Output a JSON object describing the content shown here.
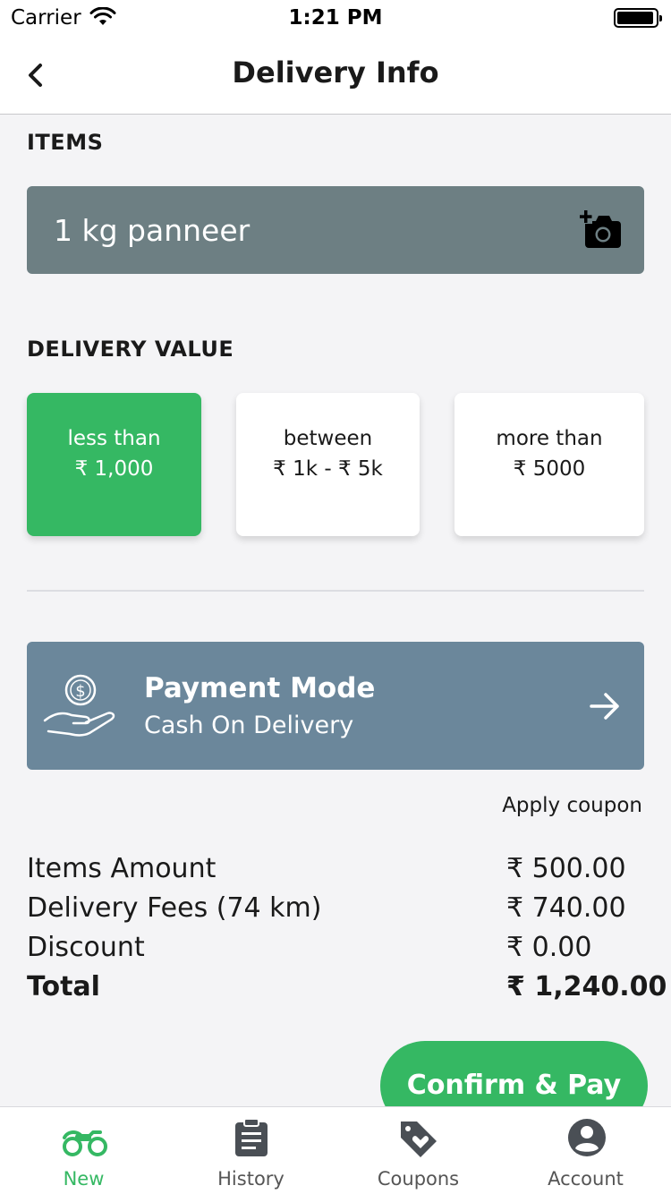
{
  "status_bar": {
    "carrier": "Carrier",
    "time": "1:21 PM"
  },
  "nav": {
    "title": "Delivery Info"
  },
  "items": {
    "label": "ITEMS",
    "value": "1 kg panneer"
  },
  "delivery_value": {
    "label": "DELIVERY VALUE",
    "options": [
      {
        "line1": "less than",
        "line2": "₹ 1,000",
        "selected": true
      },
      {
        "line1": "between",
        "line2": "₹ 1k - ₹ 5k",
        "selected": false
      },
      {
        "line1": "more than",
        "line2": "₹ 5000",
        "selected": false
      }
    ]
  },
  "payment": {
    "title": "Payment Mode",
    "subtitle": "Cash On Delivery"
  },
  "coupon": {
    "label": "Apply coupon"
  },
  "summary": [
    {
      "label": "Items Amount",
      "value": "₹ 500.00"
    },
    {
      "label": "Delivery Fees (74 km)",
      "value": "₹ 740.00"
    },
    {
      "label": "Discount",
      "value": "₹ 0.00"
    },
    {
      "label": "Total",
      "value": "₹ 1,240.00"
    }
  ],
  "confirm": {
    "label": "Confirm & Pay"
  },
  "tabs": [
    {
      "label": "New",
      "icon": "motorbike-icon",
      "active": true
    },
    {
      "label": "History",
      "icon": "clipboard-icon",
      "active": false
    },
    {
      "label": "Coupons",
      "icon": "tag-heart-icon",
      "active": false
    },
    {
      "label": "Account",
      "icon": "account-icon",
      "active": false
    }
  ],
  "colors": {
    "accent": "#35b863",
    "item_box": "#6d7f83",
    "payment_box": "#6b879b"
  }
}
